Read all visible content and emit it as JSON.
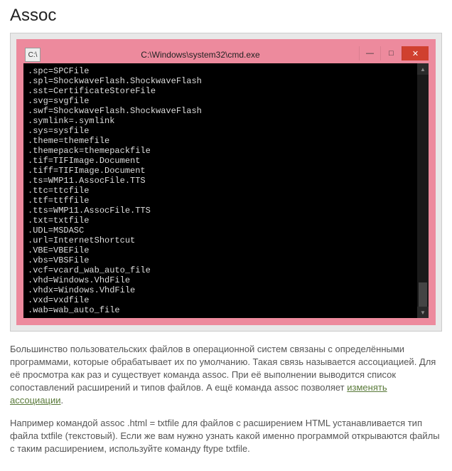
{
  "title": "Assoc",
  "cmd": {
    "icon_label": "C:\\",
    "window_title": "C:\\Windows\\system32\\cmd.exe",
    "buttons": {
      "min": "—",
      "max": "□",
      "close": "✕"
    },
    "lines": [
      ".spc=SPCFile",
      ".spl=ShockwaveFlash.ShockwaveFlash",
      ".sst=CertificateStoreFile",
      ".svg=svgfile",
      ".swf=ShockwaveFlash.ShockwaveFlash",
      ".symlink=.symlink",
      ".sys=sysfile",
      ".theme=themefile",
      ".themepack=themepackfile",
      ".tif=TIFImage.Document",
      ".tiff=TIFImage.Document",
      ".ts=WMP11.AssocFile.TTS",
      ".ttc=ttcfile",
      ".ttf=ttffile",
      ".tts=WMP11.AssocFile.TTS",
      ".txt=txtfile",
      ".UDL=MSDASC",
      ".url=InternetShortcut",
      ".VBE=VBEFile",
      ".vbs=VBSFile",
      ".vcf=vcard_wab_auto_file",
      ".vhd=Windows.VhdFile",
      ".vhdx=Windows.VhdFile",
      ".vxd=vxdfile",
      ".wab=wab_auto_file"
    ]
  },
  "paragraph1_before_link": "Большинство пользовательских файлов в операционной систем связаны с определёнными программами, которые обрабатывает их по умолчанию. Такая связь называется ассоциацией. Для её просмотра как раз и существует команда assoc. При её выполнении выводится список сопоставлений расширений и типов файлов. А ещё команда assoc позволяет ",
  "paragraph1_link": "изменять ассоциации",
  "paragraph1_after_link": ".",
  "paragraph2": "Например командой assoc .html = txtfile для файлов с расширением HTML устанавливается тип файла txtfile (текстовый). Если же вам нужно узнать какой именно программой открываются файлы с таким расширением, используйте команду ftype txtfile."
}
